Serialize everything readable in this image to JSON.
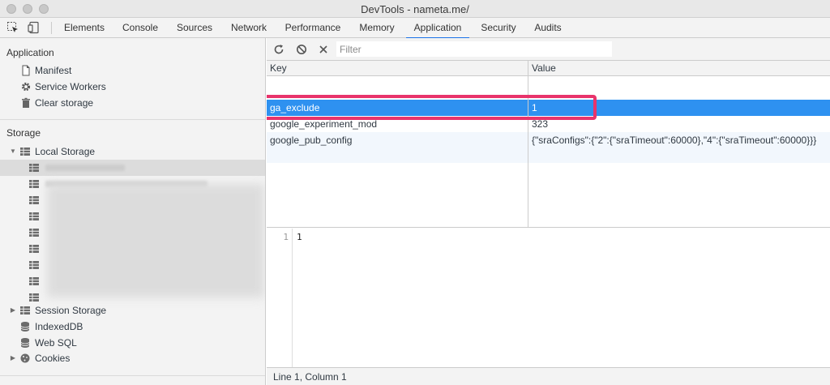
{
  "window": {
    "title": "DevTools - nameta.me/"
  },
  "tabs": [
    {
      "label": "Elements"
    },
    {
      "label": "Console"
    },
    {
      "label": "Sources"
    },
    {
      "label": "Network"
    },
    {
      "label": "Performance"
    },
    {
      "label": "Memory"
    },
    {
      "label": "Application",
      "active": true
    },
    {
      "label": "Security"
    },
    {
      "label": "Audits"
    }
  ],
  "sidebar": {
    "application": {
      "title": "Application",
      "items": [
        {
          "label": "Manifest",
          "icon": "document-icon"
        },
        {
          "label": "Service Workers",
          "icon": "gear-icon"
        },
        {
          "label": "Clear storage",
          "icon": "trash-icon"
        }
      ]
    },
    "storage": {
      "title": "Storage",
      "local_storage": "Local Storage",
      "session_storage": "Session Storage",
      "indexeddb": "IndexedDB",
      "websql": "Web SQL",
      "cookies": "Cookies"
    }
  },
  "toolbar": {
    "filter_placeholder": "Filter",
    "refresh_icon": "refresh-icon",
    "clear_icon": "block-icon",
    "delete_icon": "close-icon"
  },
  "table": {
    "columns": [
      "Key",
      "Value"
    ],
    "rows": [
      {
        "key": "ga_exclude",
        "value": "1",
        "selected": true
      },
      {
        "key": "google_experiment_mod",
        "value": "323"
      },
      {
        "key": "google_pub_config",
        "value": "{\"sraConfigs\":{\"2\":{\"sraTimeout\":60000},\"4\":{\"sraTimeout\":60000}}}"
      }
    ]
  },
  "editor": {
    "line_number": "1",
    "content": "1"
  },
  "status": {
    "text": "Line 1, Column 1"
  },
  "colors": {
    "selection": "#2e91f0",
    "highlight": "#e8336b",
    "accent": "#1a73e8"
  }
}
